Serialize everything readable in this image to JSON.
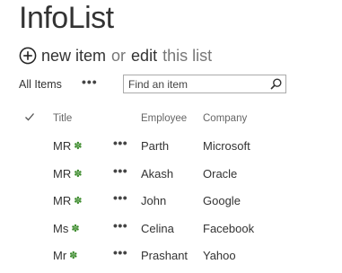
{
  "page": {
    "title": "InfoList"
  },
  "actions": {
    "new_item_label": "new item",
    "or_text": "or",
    "edit_label": "edit",
    "this_list_label": "this list",
    "plus_icon": "circle-plus-icon"
  },
  "view": {
    "current_view": "All Items",
    "ellipsis": "•••",
    "search_placeholder": "Find an item",
    "search_icon": "search-icon"
  },
  "table": {
    "columns": {
      "check": "checkmark-icon",
      "title": "Title",
      "employee": "Employee",
      "company": "Company"
    },
    "new_badge": "✽",
    "row_ellipsis": "•••",
    "rows": [
      {
        "title": "MR",
        "employee": "Parth",
        "company": "Microsoft"
      },
      {
        "title": "MR",
        "employee": "Akash",
        "company": "Oracle"
      },
      {
        "title": "MR",
        "employee": "John",
        "company": "Google"
      },
      {
        "title": "Ms",
        "employee": "Celina",
        "company": "Facebook"
      },
      {
        "title": "Mr",
        "employee": "Prashant",
        "company": "Yahoo"
      }
    ]
  },
  "colors": {
    "text": "#333333",
    "muted": "#777777",
    "new_badge": "#3a8a2a",
    "border": "#ababab"
  }
}
